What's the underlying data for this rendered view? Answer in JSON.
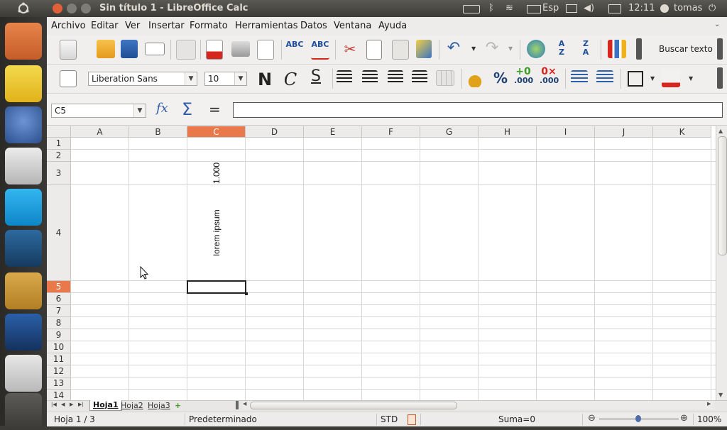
{
  "topbar": {
    "window_title": "Sin título 1 - LibreOffice Calc",
    "keyboard": "Esp",
    "time": "12:11",
    "user": "tomas"
  },
  "menubar": {
    "items": [
      "Archivo",
      "Editar",
      "Ver",
      "Insertar",
      "Formato",
      "Herramientas",
      "Datos",
      "Ventana",
      "Ayuda"
    ]
  },
  "toolbar": {
    "search_label": "Buscar texto"
  },
  "format_toolbar": {
    "font_name": "Liberation Sans",
    "font_size": "10",
    "bold_glyph": "N",
    "italic_glyph": "C",
    "underline_glyph": "S",
    "percent_glyph": "%",
    "decimal_add": ".000",
    "decimal_remove": ".000"
  },
  "formula_bar": {
    "name_box": "C5",
    "sum_glyph": "Σ",
    "equals_glyph": "=",
    "formula": ""
  },
  "sheet": {
    "columns": [
      "A",
      "B",
      "C",
      "D",
      "E",
      "F",
      "G",
      "H",
      "I",
      "J",
      "K"
    ],
    "rows": [
      "1",
      "2",
      "3",
      "4",
      "5",
      "6",
      "7",
      "8",
      "9",
      "10",
      "11",
      "12",
      "13",
      "14"
    ],
    "cell_c3": "1.000",
    "cell_c4": "lorem ipsum",
    "active_column": "C",
    "active_row": "5"
  },
  "tabs": {
    "sheet1": "Hoja1",
    "sheet2": "Hoja2",
    "sheet3": "Hoja3"
  },
  "statusbar": {
    "sheet_info": "Hoja 1 / 3",
    "page_style": "Predeterminado",
    "mode": "STD",
    "sum": "Suma=0",
    "zoom": "100%"
  },
  "colors": {
    "accent": "#e9784a",
    "panel": "#3c3b37"
  }
}
